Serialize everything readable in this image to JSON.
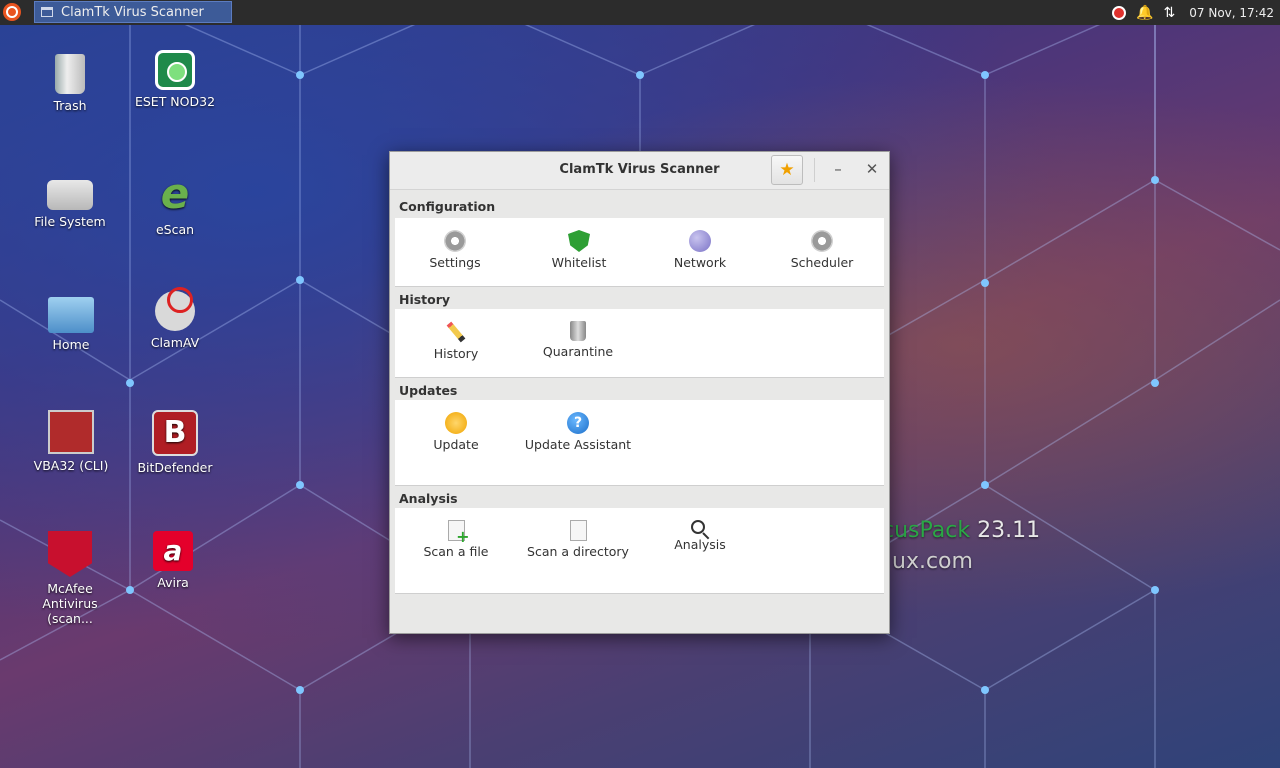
{
  "panel": {
    "task_title": "ClamTk Virus Scanner",
    "clock": "07 Nov, 17:42"
  },
  "desktop": {
    "icons": [
      {
        "label": "Trash",
        "icon": "trash-icon"
      },
      {
        "label": "ESET NOD32",
        "icon": "eset-icon"
      },
      {
        "label": "File System",
        "icon": "drive-icon"
      },
      {
        "label": "eScan",
        "icon": "escan-icon"
      },
      {
        "label": "Home",
        "icon": "home-folder-icon"
      },
      {
        "label": "ClamAV",
        "icon": "clamav-icon"
      },
      {
        "label": "VBA32 (CLI)",
        "icon": "vba32-icon"
      },
      {
        "label": "BitDefender",
        "icon": "bitdefender-icon"
      },
      {
        "label": "McAfee Antivirus (scan...",
        "icon": "mcafee-icon"
      },
      {
        "label": "Avira",
        "icon": "avira-icon"
      }
    ],
    "watermark_version": "23.11",
    "watermark_green": "cusPack",
    "watermark_url": "ux.com"
  },
  "window": {
    "title": "ClamTk Virus Scanner",
    "sections": {
      "configuration": {
        "label": "Configuration",
        "items": [
          "Settings",
          "Whitelist",
          "Network",
          "Scheduler"
        ]
      },
      "history": {
        "label": "History",
        "items": [
          "History",
          "Quarantine"
        ]
      },
      "updates": {
        "label": "Updates",
        "items": [
          "Update",
          "Update Assistant"
        ]
      },
      "analysis": {
        "label": "Analysis",
        "items": [
          "Scan a file",
          "Scan a directory",
          "Analysis"
        ]
      }
    }
  },
  "colors": {
    "panel_bg": "#2c2c2c",
    "task_active": "#3d5b98",
    "accent_green": "#2aa745"
  }
}
